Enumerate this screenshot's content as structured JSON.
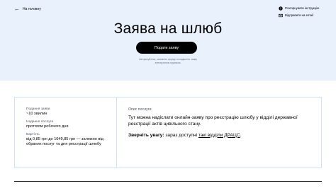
{
  "header": {
    "back_label": "На головну",
    "back_icon": "arrow-left-icon",
    "links": [
      {
        "label": "Розгорнувати інструкцію",
        "icon": "info-icon"
      },
      {
        "label": "Відправити на email",
        "icon": "mail-icon"
      }
    ]
  },
  "hero": {
    "title": "Заява на шлюб",
    "submit_label": "Подати заяву",
    "disclaimer": "Авторизуйтесь, заповніть форму та надішліть заяву електронною підписом."
  },
  "details": {
    "term_label": "Подання заяви",
    "term_value": "~10 хвилин",
    "provision_label": "Надання послуги",
    "provision_value": "протягом робочого дня",
    "cost_label": "Вартість",
    "cost_value": "від 0,85 грн до 1649,85 грн — залежно від обраних послуг та дня реєстрації шлюбу",
    "description_label": "Опис послуги",
    "description_text": "Тут можна надіслати онлайн-заяву про реєстрацію шлюбу у відділі державної реєстрації актів цивільного стану.",
    "notice_bold": "Зверніть увагу:",
    "notice_text": " зараз доступні ",
    "notice_link": "такі відділи ДРАЦС",
    "notice_end": "."
  },
  "colors": {
    "hero_bg": "#e8f1fc",
    "button_bg": "#000000",
    "card_border": "#cfe3f6"
  }
}
